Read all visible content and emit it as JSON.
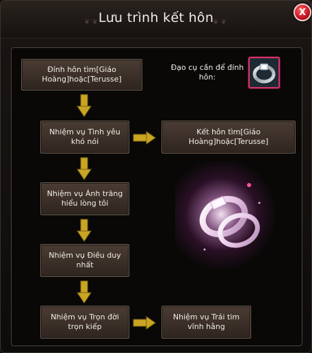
{
  "window": {
    "title": "Lưu trình kết hôn",
    "close_label": "X"
  },
  "steps": {
    "engage": "Đính hôn  tìm[Giáo Hoàng]hoặc[Terusse]",
    "quest1": "Nhiệm vụ  Tình yêu khó nói",
    "marry": "Kết hôn  tìm[Giáo Hoàng]hoặc[Terusse]",
    "quest2": "Nhiệm vụ  Ánh trăng hiểu lòng tôi",
    "quest3": "Nhiệm vụ   Điều duy nhất",
    "quest4": "Nhiệm vụ  Trọn đời trọn kiếp",
    "quest5": "Nhiệm vụ   Trái tim vĩnh hằng"
  },
  "requirement": {
    "label": "Đạo cụ cần để đính hôn:",
    "item_icon": "wedding-ring-icon"
  },
  "colors": {
    "step_bg": "#3d3029",
    "arrow": "#c9a523",
    "slot_border": "#d6336a",
    "close_red": "#c2121e"
  }
}
